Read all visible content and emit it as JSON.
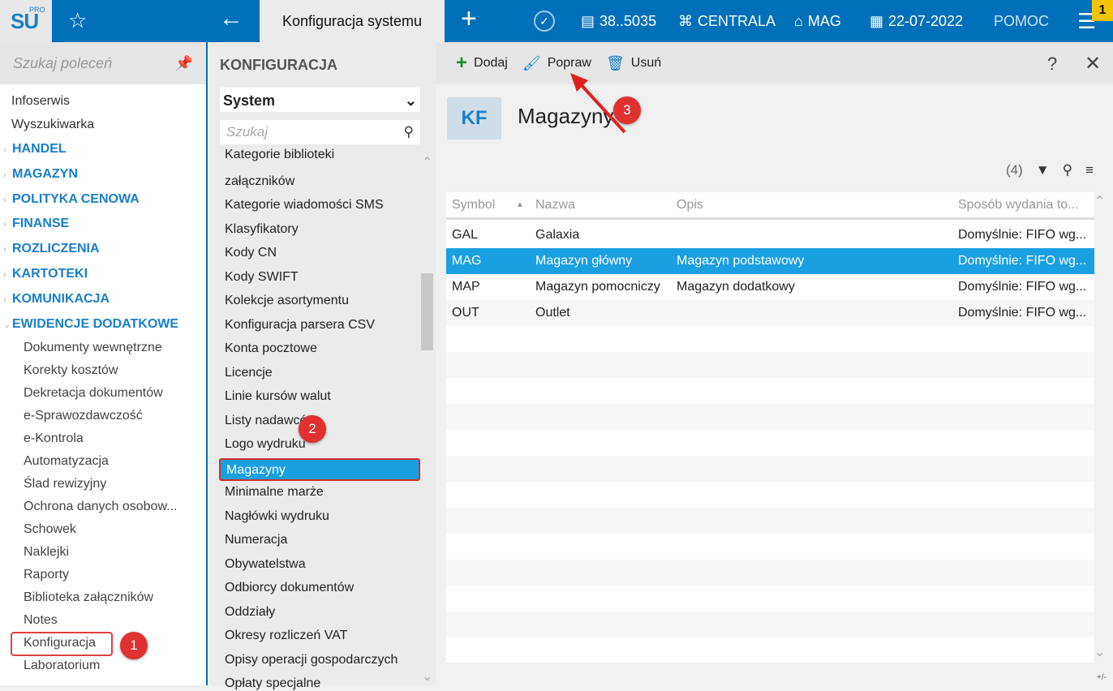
{
  "topbar": {
    "logo": "SU",
    "logo_sup": "PRO",
    "tab": "Konfiguracja systemu",
    "amount": "38..5035",
    "branch": "CENTRALA",
    "warehouse": "MAG",
    "date": "22-07-2022",
    "help": "POMOC",
    "notif": "1"
  },
  "sidebar": {
    "search_placeholder": "Szukaj poleceń",
    "top": [
      "Infoserwis",
      "Wyszukiwarka"
    ],
    "sections": [
      "HANDEL",
      "MAGAZYN",
      "POLITYKA CENOWA",
      "FINANSE",
      "ROZLICZENIA",
      "KARTOTEKI",
      "KOMUNIKACJA",
      "EWIDENCJE DODATKOWE"
    ],
    "sub": [
      "Dokumenty wewnętrzne",
      "Korekty kosztów",
      "Dekretacja dokumentów",
      "e-Sprawozdawczość",
      "e-Kontrola",
      "Automatyzacja",
      "Ślad rewizyjny",
      "Ochrona danych osobow...",
      "Schowek",
      "Naklejki",
      "Raporty",
      "Biblioteka załączników",
      "Notes",
      "Konfiguracja",
      "Laboratorium"
    ]
  },
  "middle": {
    "title": "KONFIGURACJA",
    "select": "System",
    "search_placeholder": "Szukaj",
    "items": [
      "Kategorie biblioteki",
      "załączników",
      "Kategorie wiadomości SMS",
      "Klasyfikatory",
      "Kody CN",
      "Kody SWIFT",
      "Kolekcje asortymentu",
      "Konfiguracja parsera CSV",
      "Konta pocztowe",
      "Licencje",
      "Linie kursów walut",
      "Listy nadawców",
      "Logo wydruku",
      "Magazyny",
      "Minimalne marże",
      "Nagłówki wydruku",
      "Numeracja",
      "Obywatelstwa",
      "Odbiorcy dokumentów",
      "Oddziały",
      "Okresy rozliczeń VAT",
      "Opisy operacji gospodarczych",
      "Opłaty specjalne"
    ]
  },
  "main": {
    "toolbar": {
      "add": "Dodaj",
      "edit": "Popraw",
      "delete": "Usuń",
      "help": "?"
    },
    "badge": "KF",
    "title": "Magazyny",
    "count": "(4)",
    "columns": [
      "Symbol",
      "Nazwa",
      "Opis",
      "Sposób wydania to..."
    ],
    "rows": [
      [
        "GAL",
        "Galaxia",
        "",
        "Domyślnie: FIFO wg..."
      ],
      [
        "MAG",
        "Magazyn główny",
        "Magazyn podstawowy",
        "Domyślnie: FIFO wg..."
      ],
      [
        "MAP",
        "Magazyn pomocniczy",
        "Magazyn dodatkowy",
        "Domyślnie: FIFO wg..."
      ],
      [
        "OUT",
        "Outlet",
        "",
        "Domyślnie: FIFO wg..."
      ]
    ],
    "footer": "+/-"
  },
  "annotations": [
    "1",
    "2",
    "3"
  ],
  "colors": {
    "brand": "#0070ba",
    "selection": "#1aa0e0",
    "annotation": "#e03030",
    "add": "#1e8a2e"
  }
}
